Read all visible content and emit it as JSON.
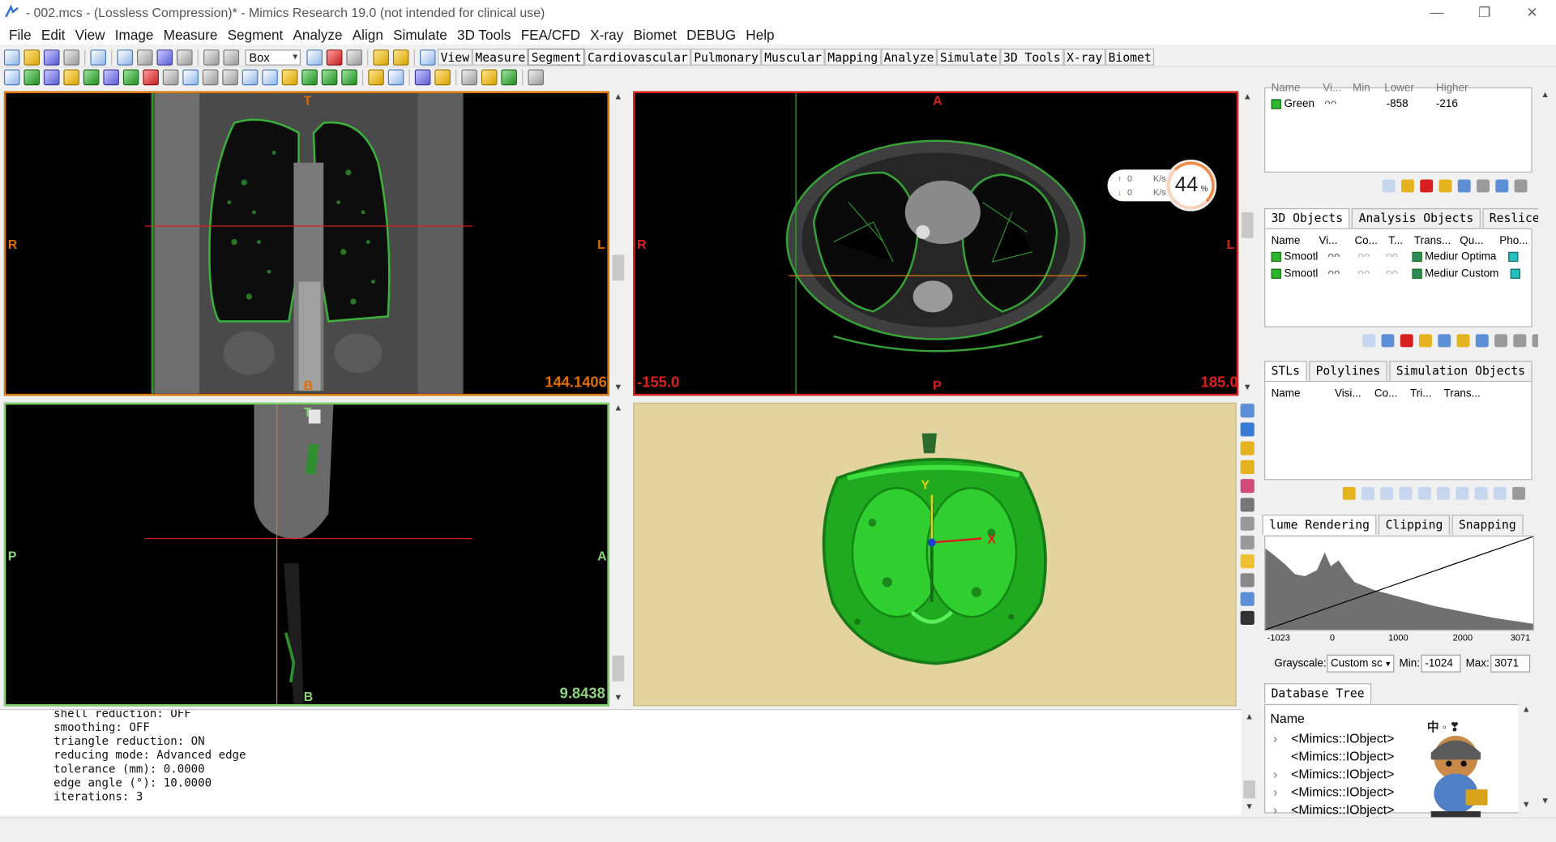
{
  "window": {
    "title": "- 002.mcs -  (Lossless Compression)* - Mimics Research 19.0 (not intended for clinical use)",
    "minimize": "—",
    "restore": "❐",
    "close": "✕"
  },
  "menu": [
    "File",
    "Edit",
    "View",
    "Image",
    "Measure",
    "Segment",
    "Analyze",
    "Align",
    "Simulate",
    "3D Tools",
    "FEA/CFD",
    "X-ray",
    "Biomet",
    "DEBUG",
    "Help"
  ],
  "toolbar": {
    "tool_select": "Box",
    "mode_tabs": [
      "View",
      "Measure",
      "Segment",
      "Cardiovascular",
      "Pulmonary",
      "Muscular",
      "Mapping",
      "Analyze",
      "Simulate",
      "3D Tools",
      "X-ray",
      "Biomet"
    ],
    "active_tab": "Segment"
  },
  "viewports": {
    "coronal": {
      "top": "T",
      "bottom": "B",
      "left": "R",
      "right": "L",
      "value": "144.1406"
    },
    "axial": {
      "top": "A",
      "bottom": "P",
      "left": "R",
      "right": "L",
      "value_left": "-155.0",
      "value_right": "185.0"
    },
    "sagittal": {
      "top": "T",
      "bottom": "B",
      "left": "P",
      "right": "A",
      "value": "9.8438"
    },
    "render": {
      "axis_y": "Y",
      "axis_x": "X"
    }
  },
  "net_widget": {
    "up": "0",
    "down": "0",
    "unit": "K/s",
    "percent": "44",
    "percent_sign": "%"
  },
  "log": {
    "lines": [
      "shell reduction: OFF",
      "smoothing: OFF",
      "triangle reduction: ON",
      "reducing mode: Advanced edge",
      "tolerance (mm): 0.0000",
      "edge angle (°): 10.0000",
      "iterations: 3"
    ]
  },
  "masks": {
    "headers": [
      "Name",
      "Vi...",
      "Min",
      "Lower",
      "Higher"
    ],
    "rows": [
      {
        "name": "Green",
        "lower": "-858",
        "higher": "-216"
      }
    ]
  },
  "objects3d": {
    "tabs": [
      "3D Objects",
      "Analysis Objects",
      "Reslice"
    ],
    "active": "3D Objects",
    "headers": [
      "Name",
      "Vi...",
      "Co...",
      "T...",
      "Trans...",
      "Qu...",
      "Pho..."
    ],
    "rows": [
      {
        "name": "Smootl",
        "quality": "Mediur Optima"
      },
      {
        "name": "Smootl",
        "quality": "Mediur Custom"
      }
    ]
  },
  "stls": {
    "tabs": [
      "STLs",
      "Polylines",
      "Simulation Objects"
    ],
    "active": "STLs",
    "headers": [
      "Name",
      "Visi...",
      "Co...",
      "Tri...",
      "Trans..."
    ]
  },
  "volume": {
    "tabs": [
      "lume Rendering",
      "Clipping",
      "Snapping"
    ],
    "active": "lume Rendering",
    "ticks": [
      "-1023",
      "0",
      "1000",
      "2000",
      "3071"
    ],
    "grayscale_label": "Grayscale:",
    "grayscale_value": "Custom sc",
    "min_label": "Min:",
    "min_value": "-1024",
    "max_label": "Max:",
    "max_value": "3071"
  },
  "database_tree": {
    "tab": "Database Tree",
    "header": "Name",
    "items": [
      "<Mimics::IObject>",
      "<Mimics::IObject>",
      "<Mimics::IObject>",
      "<Mimics::IObject>",
      "<Mimics::IObject>"
    ]
  },
  "mascot_text": "中 ◦ ❣"
}
